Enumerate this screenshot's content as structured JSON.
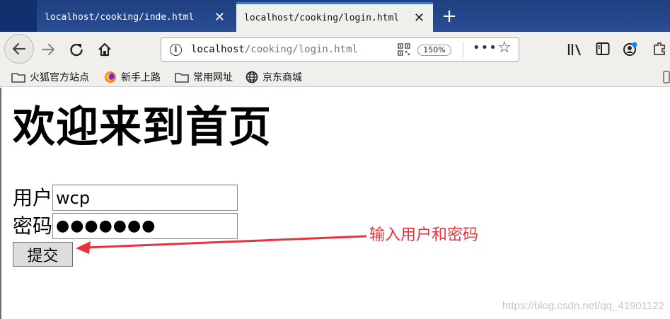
{
  "browser": {
    "tabs": [
      {
        "label": "localhost/cooking/inde.html",
        "active": false
      },
      {
        "label": "localhost/cooking/login.html",
        "active": true
      }
    ],
    "close_glyph": "✕",
    "new_tab_glyph": "+",
    "url_host": "localhost",
    "url_path": "/cooking/login.html",
    "zoom": "150%",
    "icons": [
      "back-icon",
      "forward-icon",
      "reload-icon",
      "home-icon",
      "info-icon",
      "qr-icon",
      "more-icon",
      "star-icon",
      "library-icon",
      "sidebar-icon",
      "account-icon",
      "extension-icon"
    ],
    "bookmarks": [
      {
        "label": "火狐官方站点",
        "icon": "folder-icon"
      },
      {
        "label": "新手上路",
        "icon": "firefox-icon"
      },
      {
        "label": "常用网址",
        "icon": "folder-icon"
      },
      {
        "label": "京东商城",
        "icon": "globe-icon"
      }
    ]
  },
  "page": {
    "heading": "欢迎来到首页",
    "username_label": "用户",
    "username_value": "wcp",
    "password_label": "密码",
    "password_value": "●●●●●●●",
    "submit_label": "提交"
  },
  "annotation": {
    "text": "输入用户和密码",
    "color": "#e8333b"
  },
  "watermark": "https://blog.csdn.net/qq_41901122",
  "colors": {
    "tabstrip": "#1e3f80",
    "active_tab_accent": "#0a84ff",
    "toolbar": "#f0efeb"
  }
}
